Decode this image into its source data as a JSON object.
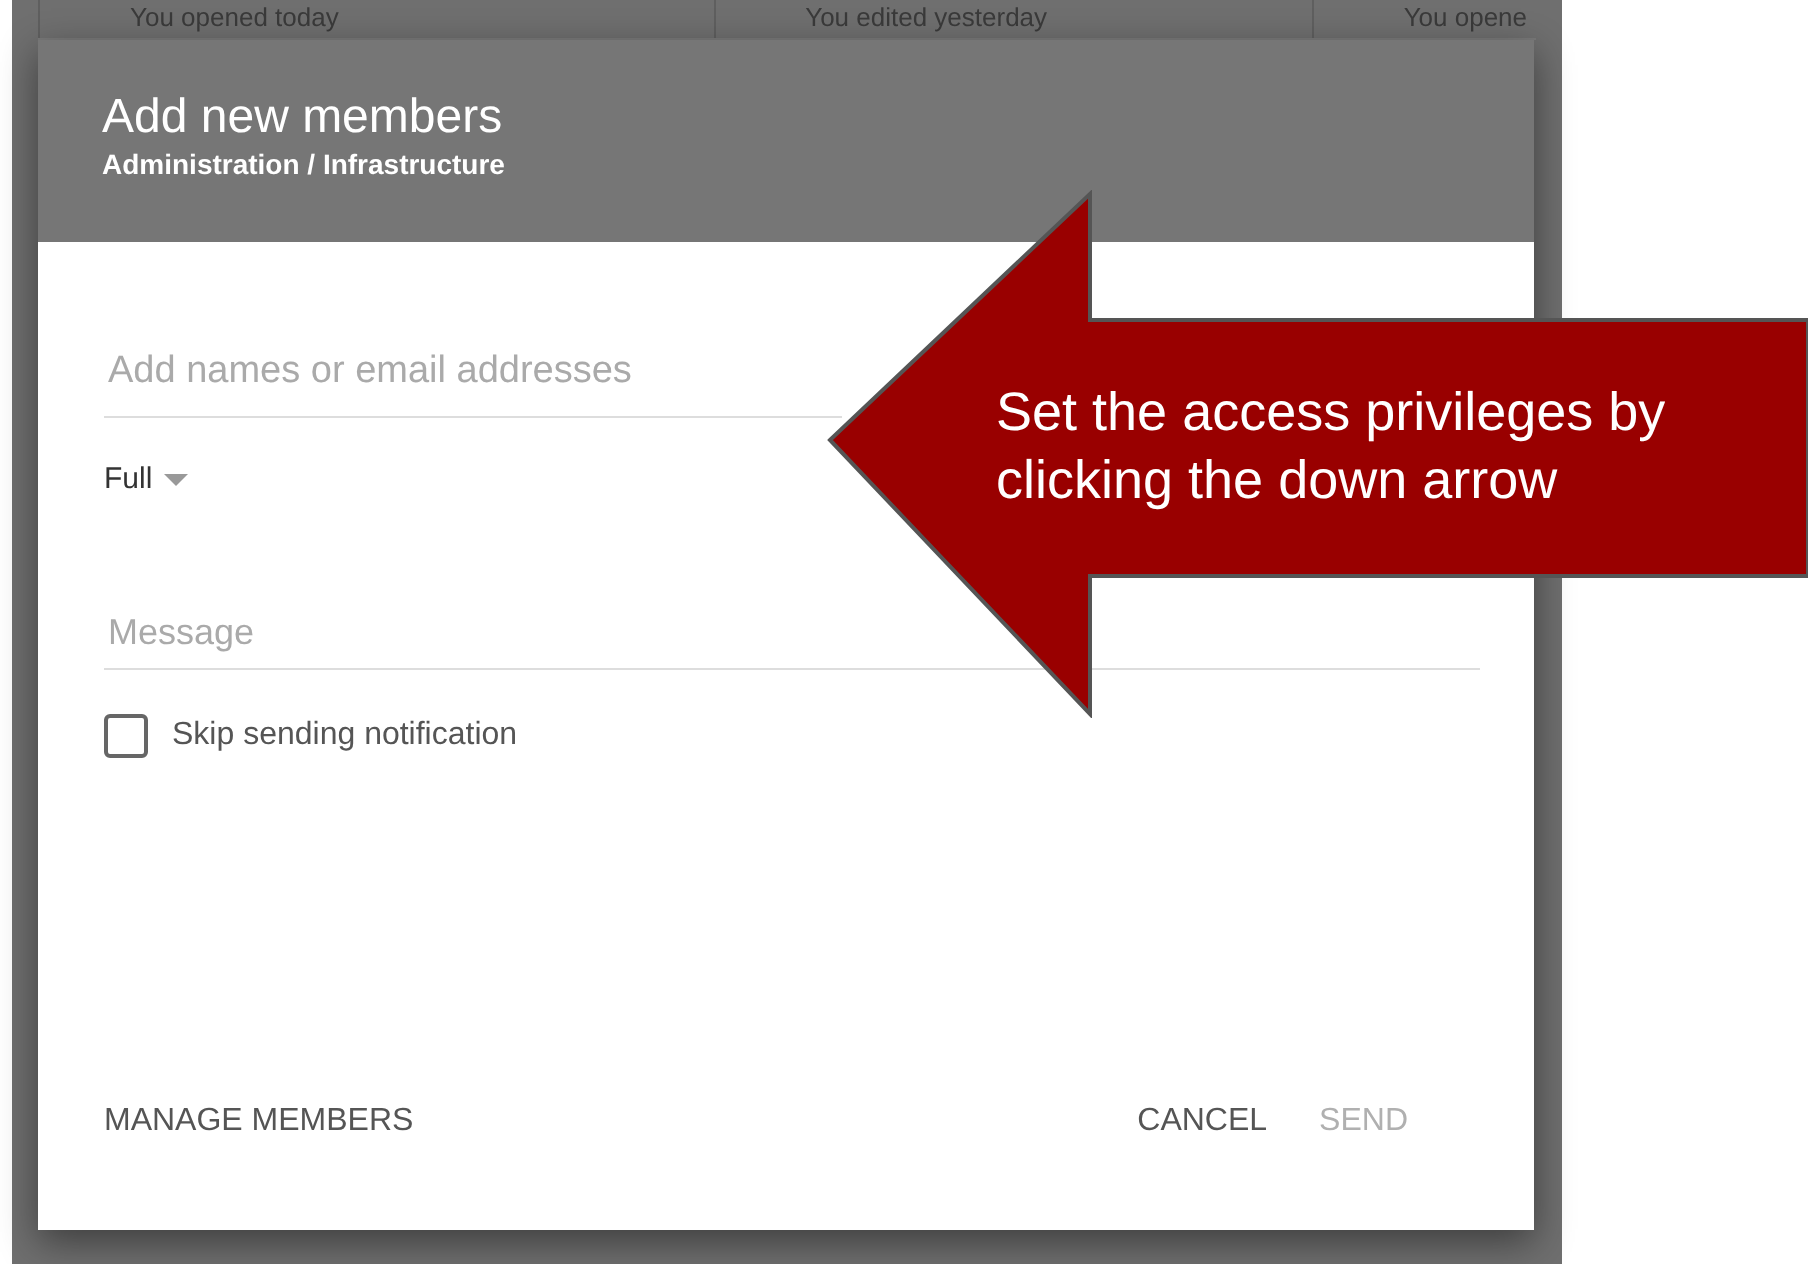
{
  "background_list": {
    "items": [
      "You opened today",
      "You edited yesterday",
      "You opene"
    ]
  },
  "dialog": {
    "title": "Add new members",
    "subtitle": "Administration / Infrastructure",
    "names_field": {
      "placeholder": "Add names or email addresses"
    },
    "access": {
      "value": "Full"
    },
    "message_field": {
      "placeholder": "Message"
    },
    "skip_notification": {
      "label": "Skip sending notification",
      "checked": false
    },
    "left_buttons": [
      {
        "label": "MANAGE MEMBERS",
        "disabled": false
      }
    ],
    "right_buttons": [
      {
        "label": "CANCEL",
        "disabled": false
      },
      {
        "label": "SEND",
        "disabled": true
      }
    ]
  },
  "callout": {
    "text": "Set the access privileges by clicking the down arrow"
  }
}
